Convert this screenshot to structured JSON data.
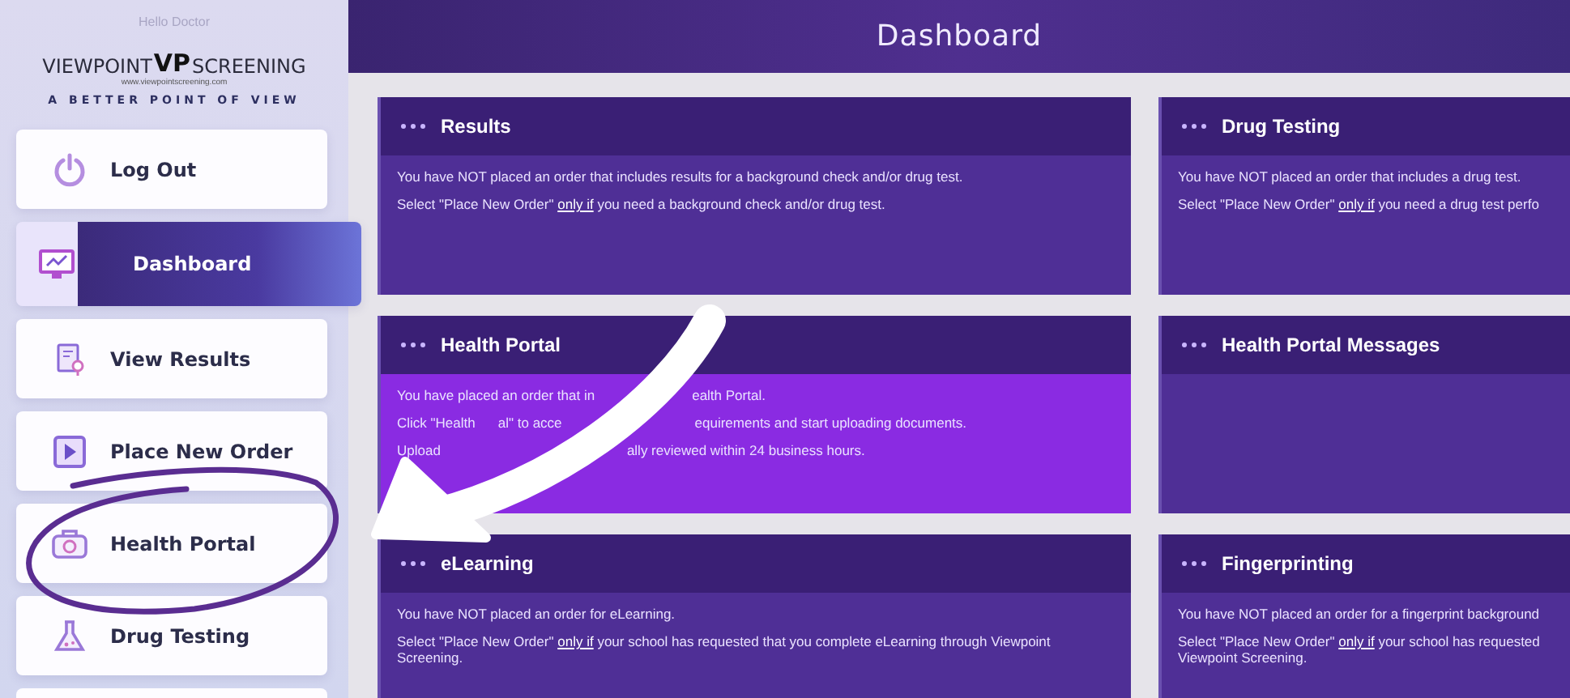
{
  "sidebar": {
    "greeting": "Hello Doctor",
    "logo": {
      "left": "VIEWPOINT",
      "mark": "VP",
      "right": "SCREENING",
      "url": "www.viewpointscreening.com"
    },
    "tagline": "A BETTER POINT OF VIEW",
    "items": [
      {
        "label": "Log Out",
        "selected": false
      },
      {
        "label": "Dashboard",
        "selected": true
      },
      {
        "label": "View Results",
        "selected": false
      },
      {
        "label": "Place New Order",
        "selected": false
      },
      {
        "label": "Health Portal",
        "selected": false
      },
      {
        "label": "Drug Testing",
        "selected": false
      }
    ]
  },
  "header": {
    "title": "Dashboard"
  },
  "cards": [
    {
      "title": "Results",
      "highlighted": false,
      "lines": [
        [
          {
            "kind": "text",
            "text": "You have NOT placed an order that includes results for a background check and/or drug test."
          }
        ],
        [
          {
            "kind": "text",
            "text": "Select \"Place New Order\" "
          },
          {
            "kind": "link",
            "text": "only if"
          },
          {
            "kind": "text",
            "text": " you need a background check and/or drug test."
          }
        ]
      ]
    },
    {
      "title": "Drug Testing",
      "highlighted": false,
      "lines": [
        [
          {
            "kind": "text",
            "text": "You have NOT placed an order that includes a drug test."
          }
        ],
        [
          {
            "kind": "text",
            "text": "Select \"Place New Order\" "
          },
          {
            "kind": "link",
            "text": "only if"
          },
          {
            "kind": "text",
            "text": " you need a drug test perfo"
          }
        ]
      ]
    },
    {
      "title": "Health Portal",
      "highlighted": true,
      "lines": [
        [
          {
            "kind": "text",
            "text": "You have placed an order that in"
          },
          {
            "kind": "covered"
          },
          {
            "kind": "text",
            "text": "ealth Portal."
          }
        ],
        [
          {
            "kind": "text",
            "text": "Click \"Health"
          },
          {
            "kind": "covered"
          },
          {
            "kind": "text",
            "text": "al\" to acce"
          },
          {
            "kind": "covered"
          },
          {
            "kind": "text",
            "text": "equirements and start uploading documents."
          }
        ],
        [
          {
            "kind": "text",
            "text": "Upload"
          },
          {
            "kind": "covered"
          },
          {
            "kind": "text",
            "text": "ally reviewed within 24 business hours."
          }
        ]
      ]
    },
    {
      "title": "Health Portal Messages",
      "highlighted": false
    },
    {
      "title": "eLearning",
      "highlighted": false,
      "lines": [
        [
          {
            "kind": "text",
            "text": "You have NOT placed an order for eLearning."
          }
        ],
        [
          {
            "kind": "text",
            "text": "Select \"Place New Order\" "
          },
          {
            "kind": "link",
            "text": "only if"
          },
          {
            "kind": "text",
            "text": " your school has requested that you complete eLearning through Viewpoint Screening."
          }
        ]
      ]
    },
    {
      "title": "Fingerprinting",
      "highlighted": false,
      "lines": [
        [
          {
            "kind": "text",
            "text": "You have NOT placed an order for a fingerprint background"
          }
        ],
        [
          {
            "kind": "text",
            "text": "Select \"Place New Order\" "
          },
          {
            "kind": "link",
            "text": "only if"
          },
          {
            "kind": "text",
            "text": " your school has requested"
          }
        ],
        [
          {
            "kind": "text",
            "text": "Viewpoint Screening."
          }
        ]
      ]
    }
  ]
}
